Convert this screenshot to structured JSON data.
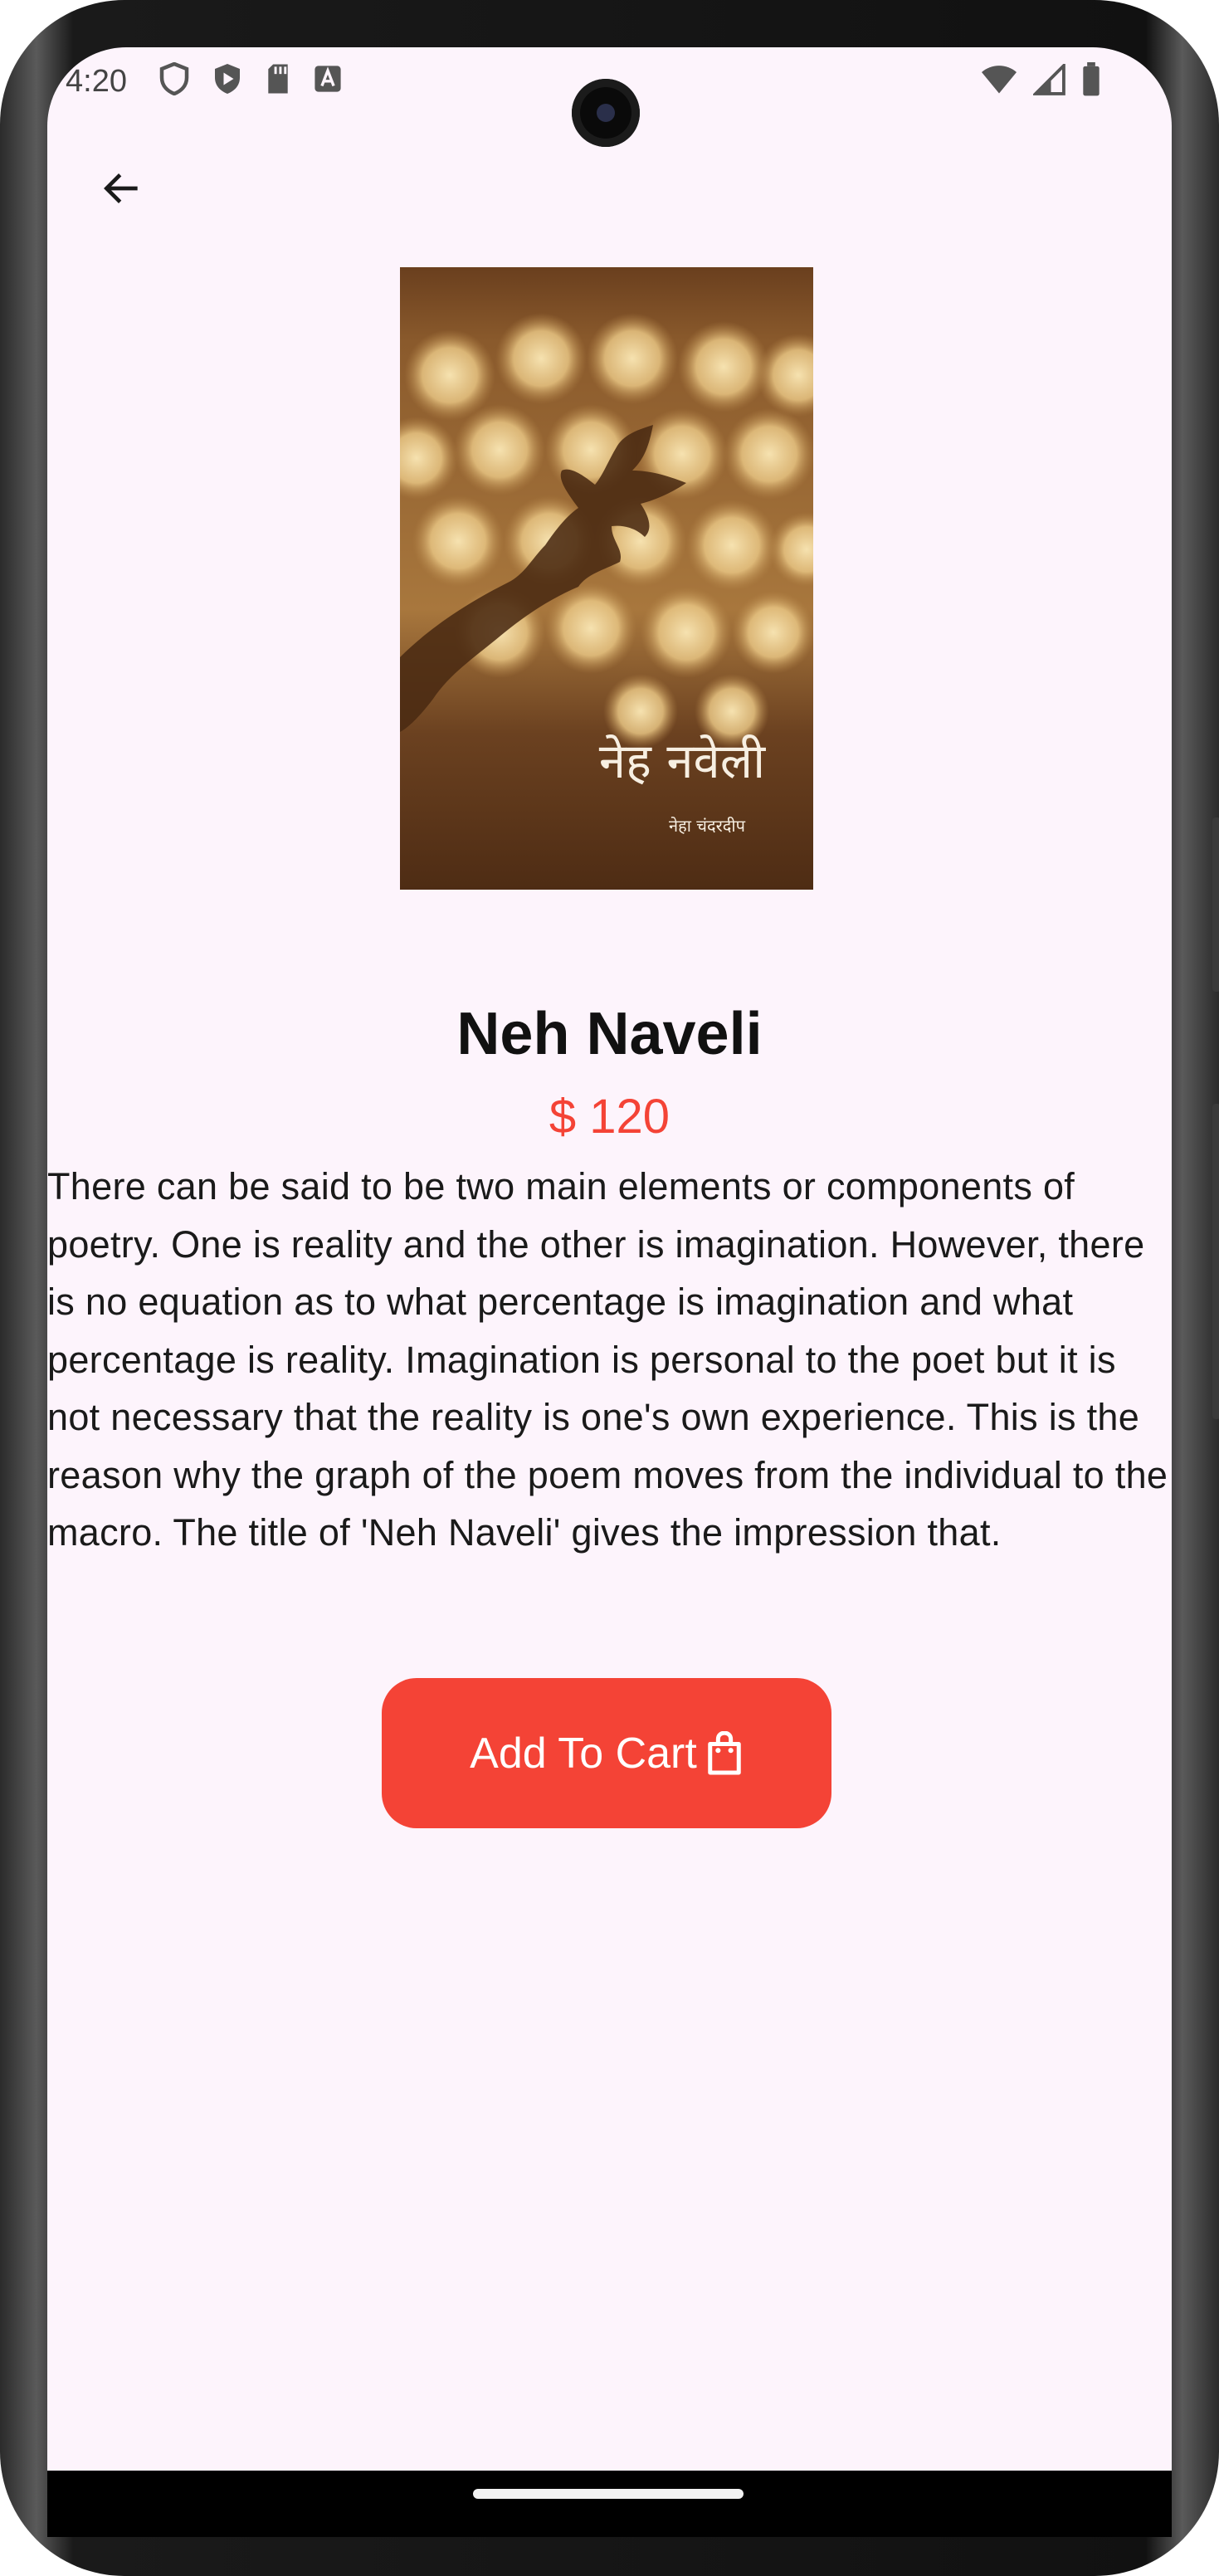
{
  "status_bar": {
    "time": "4:20",
    "left_icons": [
      "shield-icon",
      "play-shield-icon",
      "sd-card-icon",
      "font-a-icon"
    ],
    "right_icons": [
      "wifi-icon",
      "cellular-signal-icon",
      "battery-icon"
    ]
  },
  "nav": {
    "back_icon": "arrow-left-icon"
  },
  "book": {
    "cover": {
      "title_text": "नेह नवेली",
      "author_text": "नेहा चंदरदीप"
    },
    "title": "Neh Naveli",
    "price": "$ 120",
    "description": "There can be said to be two main elements or components of poetry. One is reality and the other is imagination. However, there is no equation as to what percentage is imagination and what percentage is reality. Imagination is personal to the poet but it is not necessary that the reality is one's own experience. This is the reason why the graph of the poem moves from the individual to the macro. The title of 'Neh Naveli' gives the impression that."
  },
  "actions": {
    "add_to_cart_label": "Add To Cart",
    "add_to_cart_icon": "shopping-bag-icon"
  },
  "colors": {
    "accent": "#f44336",
    "background": "#fdf4fc",
    "text": "#1a1a1a"
  }
}
